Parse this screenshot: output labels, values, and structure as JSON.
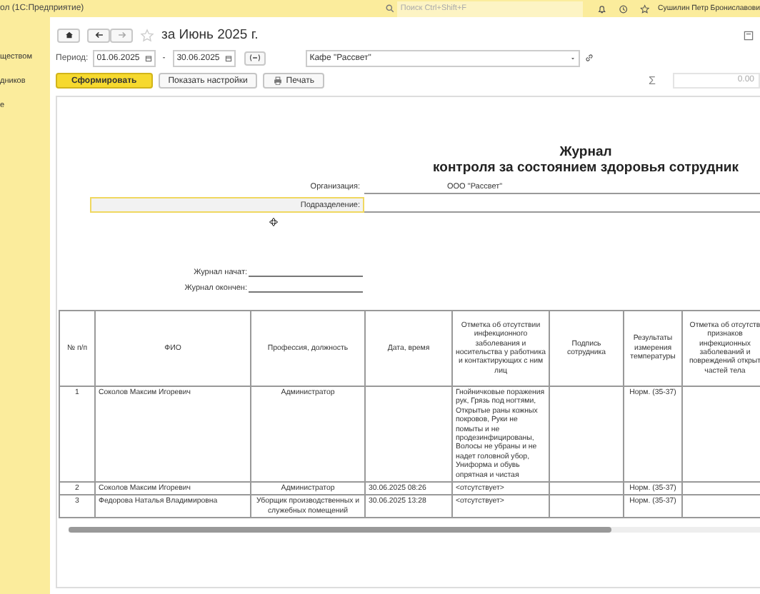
{
  "app_bar": {
    "title": "ол (1С:Предприятие)",
    "search": {
      "placeholder": "Поиск Ctrl+Shift+F"
    },
    "user": "Сушилин Петр Брониславови"
  },
  "sidebar": {
    "items": [
      "ществом",
      "дников",
      "е"
    ]
  },
  "form": {
    "title": "за Июнь 2025 г.",
    "period_label": "Период:",
    "date_from": "01.06.2025",
    "separator": "-",
    "date_to": "30.06.2025",
    "organization": "Кафе \"Рассвет\"",
    "buttons": [
      {
        "label": "Сформировать",
        "kind": "primary"
      },
      {
        "label": "Показать настройки",
        "kind": "plain"
      },
      {
        "label": "Печать",
        "kind": "print"
      }
    ],
    "sum_symbol": "Σ",
    "sum_value": "0.00"
  },
  "report": {
    "title": "Журнал",
    "subtitle": "контроля за состоянием здоровья сотрудник",
    "fields": [
      {
        "label": "Организация:",
        "value": "ООО \"Рассвет\"",
        "selected": false
      },
      {
        "label": "Подразделение:",
        "selected": true
      }
    ],
    "signatures": [
      "Журнал начат:",
      "Журнал окончен:"
    ],
    "table": {
      "columns": [
        "№ п/п",
        "ФИО",
        "Профессия, должность",
        "Дата, время",
        "Отметка об отсутствии инфекционного заболевания и носительства у работника и контактирующих с ним лиц",
        "Подпись сотрудника",
        "Результаты измерения температуры",
        "Отметка об отсутств признаков инфекционных заболеваний и повреждений открыт частей тела"
      ],
      "rows": [
        {
          "n": "1",
          "name": "Соколов Максим Игоревич",
          "position": "Администратор",
          "infection_note": "Гнойничковые поражения рук, Грязь под ногтями, Открытые раны кожных покровов, Руки не помыты и не продезинфицированы, Волосы не убраны и не надет головной убор, Униформа и обувь опрятная и чистая",
          "temperature": "Норм. (35-37)"
        },
        {
          "n": "2",
          "name": "Соколов Максим Игоревич",
          "position": "Администратор",
          "datetime": "30.06.2025 08:26",
          "infection_note": "<отсутствует>",
          "temperature": "Норм. (35-37)"
        },
        {
          "n": "3",
          "name": "Федорова Наталья Владимировна",
          "position": "Уборщик производственных и служебных помещений",
          "datetime": "30.06.2025 13:28",
          "infection_note": "<отсутствует>",
          "temperature": "Норм. (35-37)"
        }
      ]
    }
  }
}
